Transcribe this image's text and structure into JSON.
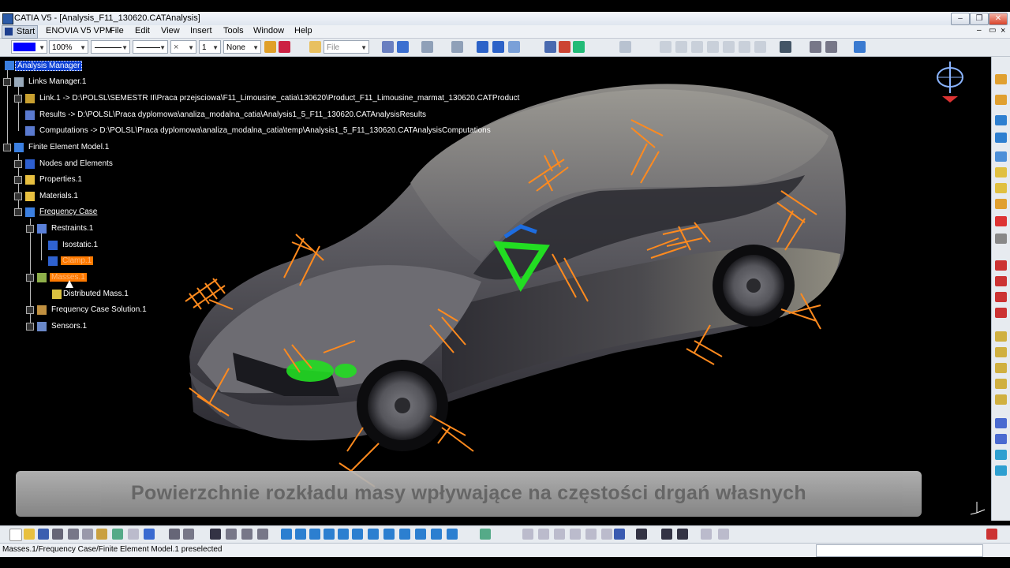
{
  "window": {
    "title": "CATIA V5 - [Analysis_F11_130620.CATAnalysis]",
    "controls": [
      "–",
      "❐",
      "✕"
    ],
    "doc_controls": [
      "–",
      "▭",
      "×"
    ]
  },
  "menu": {
    "start": "Start",
    "items": [
      "ENOVIA V5 VPM",
      "File",
      "Edit",
      "View",
      "Insert",
      "Tools",
      "Window",
      "Help"
    ]
  },
  "toolbar": {
    "zoom_value": "100%",
    "layer_value": "None",
    "file_value": "File",
    "number_value": "1"
  },
  "tree": {
    "root": "Analysis Manager",
    "links_manager": "Links Manager.1",
    "link1": "Link.1 -> D:\\POLSL\\SEMESTR II\\Praca przejsciowa\\F11_Limousine_catia\\130620\\Product_F11_Limousine_marmat_130620.CATProduct",
    "results": "Results -> D:\\POLSL\\Praca dyplomowa\\analiza_modalna_catia\\Analysis1_5_F11_130620.CATAnalysisResults",
    "computations": "Computations -> D:\\POLSL\\Praca dyplomowa\\analiza_modalna_catia\\temp\\Analysis1_5_F11_130620.CATAnalysisComputations",
    "fem": "Finite Element Model.1",
    "nodes": "Nodes and Elements",
    "properties": "Properties.1",
    "materials": "Materials.1",
    "frequency_case": "Frequency Case",
    "restraints": "Restraints.1",
    "isostatic": "Isostatic.1",
    "clamp": "Clamp.1",
    "masses": "Masses.1",
    "distributed_mass": "Distributed Mass.1",
    "solution": "Frequency Case Solution.1",
    "sensors": "Sensors.1"
  },
  "banner": {
    "text": "Powierzchnie rozkładu masy wpływające na częstości drgań własnych"
  },
  "status": {
    "text": "Masses.1/Frequency Case/Finite Element Model.1 preselected"
  },
  "colors": {
    "restraint": "#ff8a1e",
    "mass": "#22dd22",
    "selection": "#0a3fd4",
    "highlight": "#ff7a00"
  }
}
